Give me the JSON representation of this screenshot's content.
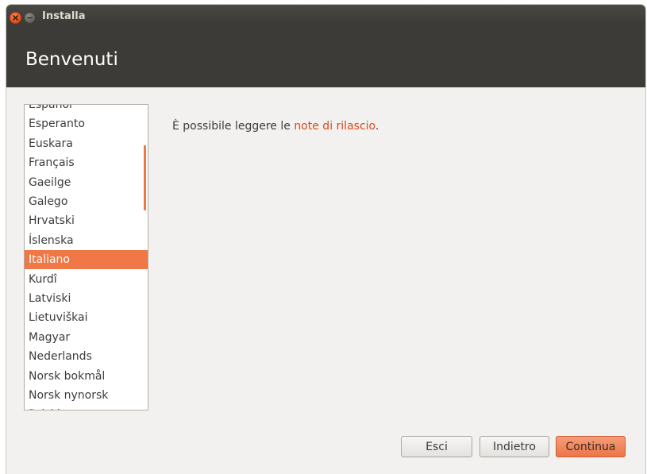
{
  "window": {
    "title": "Installa",
    "page_title": "Benvenuti"
  },
  "language_list": {
    "items": [
      {
        "label": "Español",
        "selected": false
      },
      {
        "label": "Esperanto",
        "selected": false
      },
      {
        "label": "Euskara",
        "selected": false
      },
      {
        "label": "Français",
        "selected": false
      },
      {
        "label": "Gaeilge",
        "selected": false
      },
      {
        "label": "Galego",
        "selected": false
      },
      {
        "label": "Hrvatski",
        "selected": false
      },
      {
        "label": "Íslenska",
        "selected": false
      },
      {
        "label": "Italiano",
        "selected": true
      },
      {
        "label": "Kurdî",
        "selected": false
      },
      {
        "label": "Latviski",
        "selected": false
      },
      {
        "label": "Lietuviškai",
        "selected": false
      },
      {
        "label": "Magyar",
        "selected": false
      },
      {
        "label": "Nederlands",
        "selected": false
      },
      {
        "label": "Norsk bokmål",
        "selected": false
      },
      {
        "label": "Norsk nynorsk",
        "selected": false
      },
      {
        "label": "Polski",
        "selected": false
      }
    ]
  },
  "main": {
    "text_prefix": "È possibile leggere le ",
    "link_text": "note di rilascio",
    "text_suffix": "."
  },
  "buttons": {
    "quit": "Esci",
    "back": "Indietro",
    "continue": "Continua"
  },
  "colors": {
    "accent": "#f07746",
    "titlebar": "#3c3b37",
    "link": "#dd4814"
  }
}
